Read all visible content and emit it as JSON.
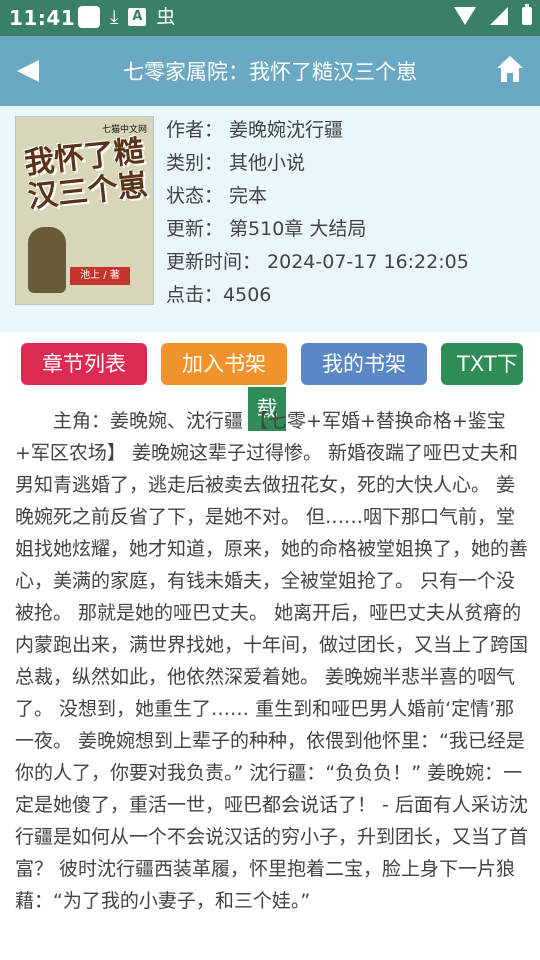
{
  "status": {
    "time": "11:41",
    "icons_left": [
      "square-notification-icon",
      "download-icon",
      "a-icon",
      "bug-icon"
    ],
    "icons_right": [
      "wifi-icon",
      "signal-icon",
      "battery-icon"
    ]
  },
  "appbar": {
    "title": "七零家属院：我怀了糙汉三个崽",
    "bg_color": "#6aa9c4"
  },
  "book": {
    "cover": {
      "publisher": "七猫中文网",
      "title": "我怀了糙汉三个崽",
      "author_badge": "池上 / 著"
    },
    "meta": [
      {
        "label": "作者：",
        "value": "姜晚婉沈行疆"
      },
      {
        "label": "类别：",
        "value": "其他小说"
      },
      {
        "label": "状态：",
        "value": "完本"
      },
      {
        "label": "更新：",
        "value": "第510章 大结局"
      },
      {
        "label": "更新时间：",
        "value": "2024-07-17 16:22:05"
      },
      {
        "label": "点击：",
        "value": "4506"
      }
    ]
  },
  "buttons": {
    "chapters": "章节列表",
    "add_shelf": "加入书架",
    "my_shelf": "我的书架",
    "txt_download_a": "TXT下",
    "txt_download_b": "载"
  },
  "synopsis": "　　主角：姜晚婉、沈行疆 【七零+军婚+替换命格+鉴宝+军区农场】 姜晚婉这辈子过得惨。 新婚夜踹了哑巴丈夫和男知青逃婚了，逃走后被卖去做扭花女，死的大快人心。 姜晚婉死之前反省了下，是她不对。 但……咽下那口气前，堂姐找她炫耀，她才知道，原来，她的命格被堂姐换了，她的善心，美满的家庭，有钱未婚夫，全被堂姐抢了。 只有一个没被抢。 那就是她的哑巴丈夫。 她离开后，哑巴丈夫从贫瘠的内蒙跑出来，满世界找她，十年间，做过团长，又当上了跨国总裁，纵然如此，他依然深爱着她。 姜晚婉半悲半喜的咽气了。 没想到，她重生了…… 重生到和哑巴男人婚前‘定情’那一夜。 姜晚婉想到上辈子的种种，依偎到他怀里：“我已经是你的人了，你要对我负责。” 沈行疆：“负负负！” 姜晚婉：一定是她傻了，重活一世，哑巴都会说话了！ - 后面有人采访沈行疆是如何从一个不会说汉话的穷小子，升到团长，又当了首富？ 彼时沈行疆西装革履，怀里抱着二宝，脸上身下一片狼藉：“为了我的小妻子，和三个娃。”"
}
